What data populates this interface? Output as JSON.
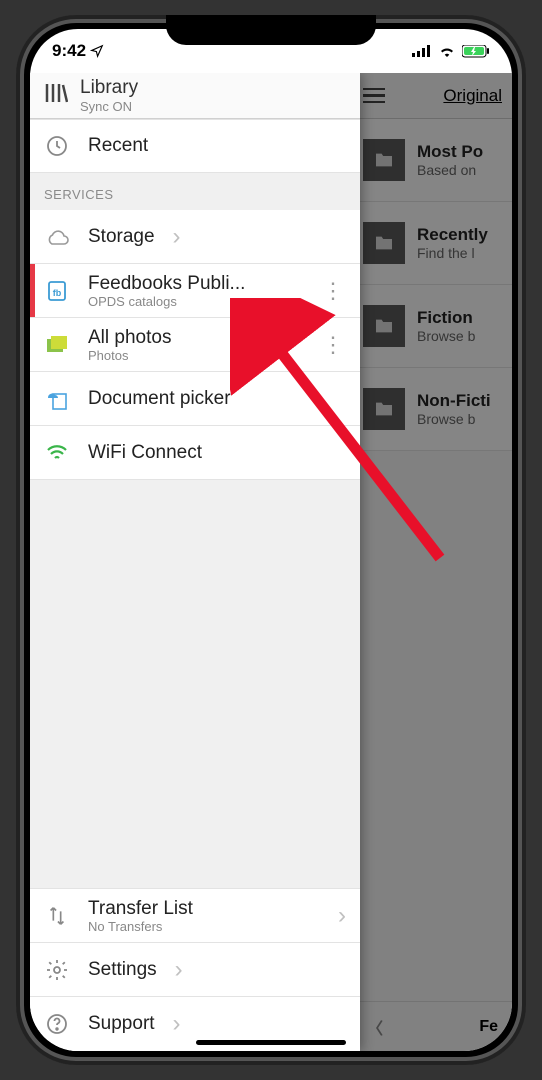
{
  "status_bar": {
    "time": "9:42"
  },
  "drawer": {
    "title": "Library",
    "sync_status": "Sync ON",
    "recent_label": "Recent",
    "services_header": "SERVICES",
    "storage_label": "Storage",
    "feedbooks": {
      "title": "Feedbooks Publi...",
      "sub": "OPDS catalogs"
    },
    "all_photos": {
      "title": "All photos",
      "sub": "Photos"
    },
    "doc_picker_label": "Document picker",
    "wifi_label": "WiFi Connect",
    "transfer": {
      "title": "Transfer List",
      "sub": "No Transfers"
    },
    "settings_label": "Settings",
    "support_label": "Support"
  },
  "background_list": {
    "header_right": "Original",
    "items": [
      {
        "title": "Most Po",
        "sub": "Based on"
      },
      {
        "title": "Recently",
        "sub": "Find the l"
      },
      {
        "title": "Fiction",
        "sub": "Browse b"
      },
      {
        "title": "Non-Ficti",
        "sub": "Browse b"
      }
    ],
    "footer_right": "Fe"
  }
}
